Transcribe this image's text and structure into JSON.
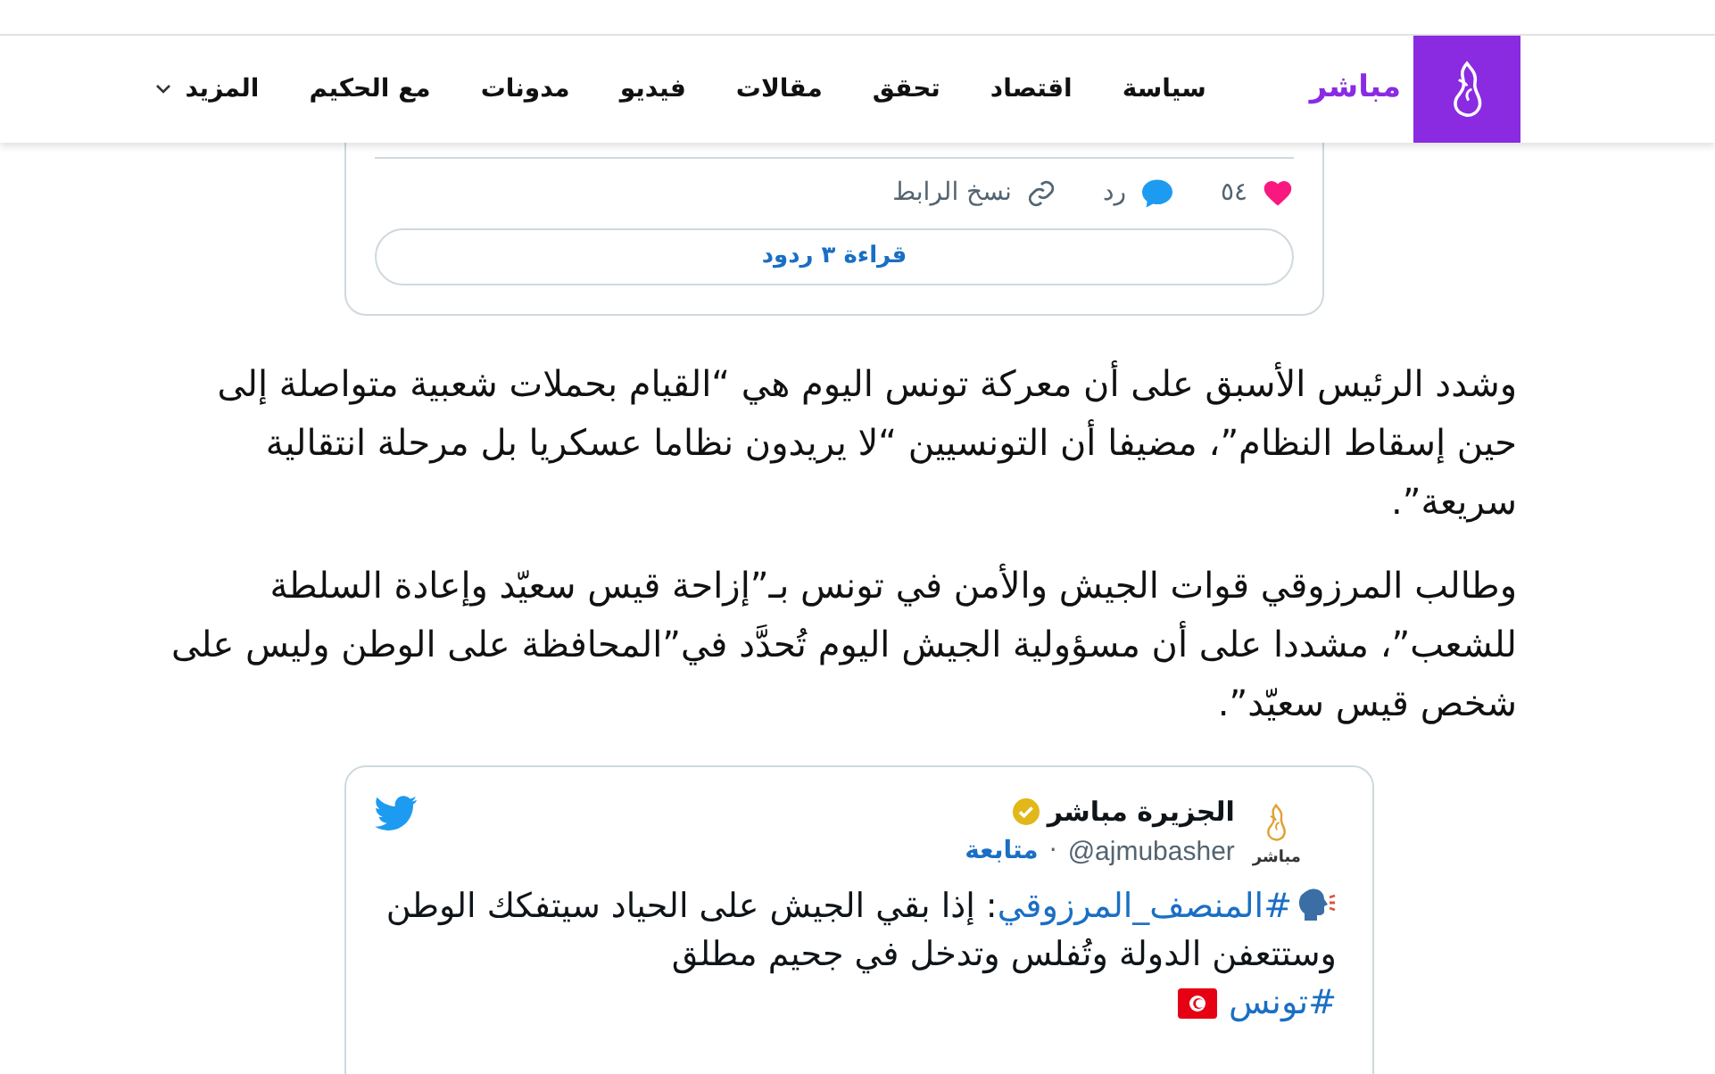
{
  "header": {
    "brand": "مباشر",
    "nav": [
      {
        "label": "سياسة",
        "kind": "link"
      },
      {
        "label": "اقتصاد",
        "kind": "link"
      },
      {
        "label": "تحقق",
        "kind": "link"
      },
      {
        "label": "مقالات",
        "kind": "link"
      },
      {
        "label": "فيديو",
        "kind": "link"
      },
      {
        "label": "مدونات",
        "kind": "link"
      },
      {
        "label": "مع الحكيم",
        "kind": "link"
      },
      {
        "label": "المزيد",
        "kind": "dropdown"
      }
    ]
  },
  "embed_1": {
    "likes": "٥٤",
    "reply": "رد",
    "copy_link": "نسخ الرابط",
    "read_replies": "قراءة ٣ ردود"
  },
  "paragraphs": [
    "وشدد الرئيس الأسبق على أن معركة تونس اليوم هي “القيام بحملات شعبية متواصلة إلى حين إسقاط النظام”، مضيفا أن التونسيين “لا يريدون نظاما عسكريا بل مرحلة انتقالية سريعة”.",
    "وطالب المرزوقي قوات الجيش والأمن في تونس بـ”إزاحة قيس سعيّد وإعادة السلطة للشعب”، مشددا على أن مسؤولية الجيش اليوم تُحدَّد في”المحافظة على الوطن وليس على شخص قيس سعيّد”."
  ],
  "embed_2": {
    "avatar_label": "مباشر",
    "name": "الجزيرة مباشر",
    "verified": true,
    "handle": "@ajmubasher",
    "separator": "·",
    "follow": "متابعة",
    "body": [
      {
        "kind": "hashtag",
        "text": "#المنصف_المرزوقي"
      },
      {
        "kind": "text",
        "text": ": إذا بقي الجيش على الحياد سيتفكك الوطن وستتعفن الدولة وتُفلس وتدخل في جحيم مطلق"
      }
    ],
    "tags": [
      {
        "kind": "hashtag",
        "text": "#تونس"
      }
    ]
  }
}
